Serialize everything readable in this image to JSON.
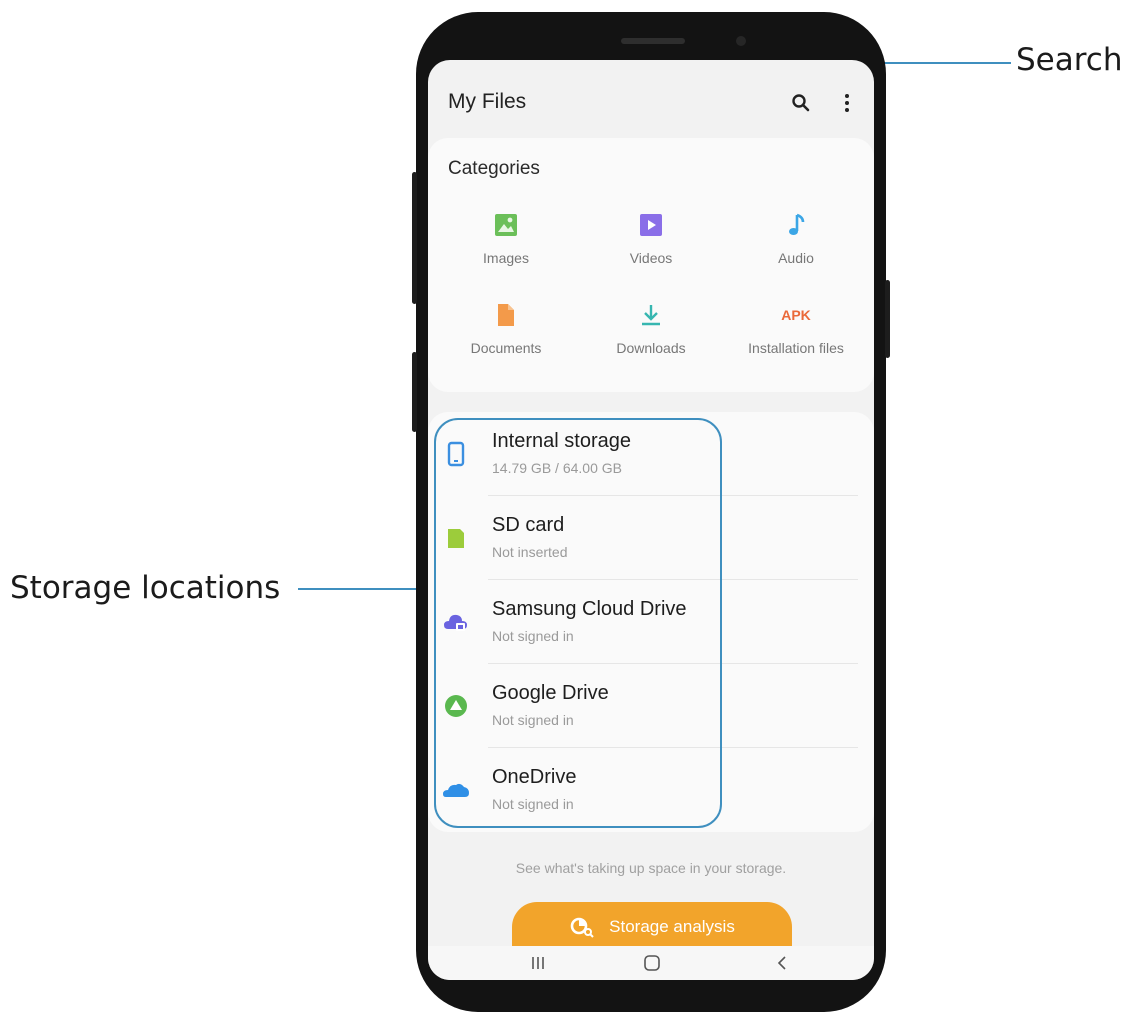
{
  "callouts": {
    "search": "Search",
    "storage": "Storage locations"
  },
  "app": {
    "title": "My Files"
  },
  "toolbar": {
    "search_icon": "search-icon",
    "more_icon": "more-vert-icon"
  },
  "categories": {
    "title": "Categories",
    "items": [
      {
        "label": "Images",
        "icon": "image-icon",
        "color": "#6bbf59"
      },
      {
        "label": "Videos",
        "icon": "video-icon",
        "color": "#8a6ee8"
      },
      {
        "label": "Audio",
        "icon": "music-note-icon",
        "color": "#3ba6e6"
      },
      {
        "label": "Documents",
        "icon": "document-icon",
        "color": "#f39a4a"
      },
      {
        "label": "Downloads",
        "icon": "download-icon",
        "color": "#36b6b0"
      },
      {
        "label": "Installation files",
        "icon": "APK",
        "color": "#ea6a3a"
      }
    ]
  },
  "storage": {
    "items": [
      {
        "name": "Internal storage",
        "detail": "14.79 GB / 64.00 GB",
        "icon": "phone-icon",
        "color": "#3b8fe0"
      },
      {
        "name": "SD card",
        "detail": "Not inserted",
        "icon": "sd-card-icon",
        "color": "#9ccc3b"
      },
      {
        "name": "Samsung Cloud Drive",
        "detail": "Not signed in",
        "icon": "cloud-lock-icon",
        "color": "#6a63e0"
      },
      {
        "name": "Google Drive",
        "detail": "Not signed in",
        "icon": "google-drive-icon",
        "color": "#5ab84f"
      },
      {
        "name": "OneDrive",
        "detail": "Not signed in",
        "icon": "onedrive-icon",
        "color": "#2f8fe6"
      }
    ]
  },
  "hint": "See what's taking up space in your storage.",
  "analysis_button": {
    "label": "Storage analysis",
    "color": "#f2a42b"
  }
}
